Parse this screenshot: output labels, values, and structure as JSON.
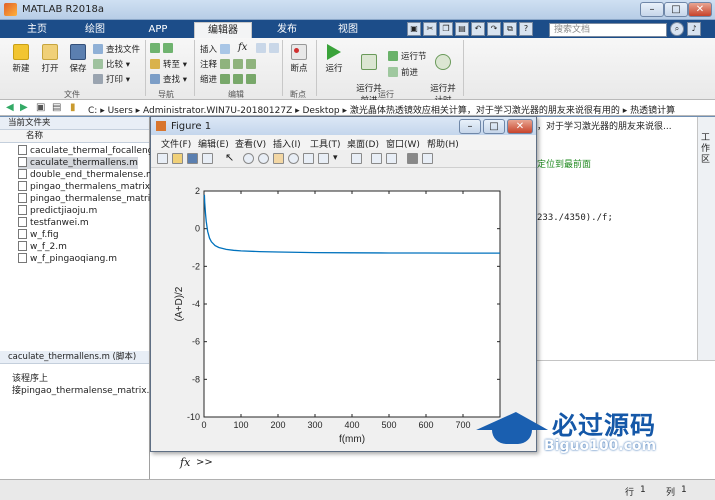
{
  "window": {
    "title": "MATLAB R2018a"
  },
  "tabs": [
    "主页",
    "绘图",
    "APP",
    "编辑器",
    "发布",
    "视图"
  ],
  "search": {
    "placeholder": "搜索文档"
  },
  "ribbon": {
    "file": {
      "new": "新建",
      "open": "打开",
      "save": "保存",
      "find_files": "查找文件",
      "compare": "比较",
      "print": "打印",
      "group": "文件"
    },
    "navigate": {
      "goto": "转至",
      "find": "查找",
      "group": "导航"
    },
    "edit": {
      "insert": "插入",
      "comment": "注释",
      "indent": "缩进",
      "fx": "fx",
      "group": "编辑"
    },
    "breakpoints": {
      "label": "断点",
      "group": "断点"
    },
    "run": {
      "run": "运行",
      "run_advance": "运行并\n前进",
      "run_section": "运行节",
      "advance": "前进",
      "run_time": "运行并\n计时",
      "group": "运行"
    }
  },
  "address": {
    "segments": [
      "C:",
      "Users",
      "Administrator.WIN7U-20180127Z",
      "Desktop",
      "激光晶体热透镜效应相关计算，对于学习激光器的朋友来说很有用的",
      "热透镜计算"
    ]
  },
  "file_panel": {
    "title": "当前文件夹",
    "column": "名称",
    "files": [
      "caculate_thermal_focallength.m",
      "caculate_thermallens.m",
      "double_end_thermalense.m",
      "pingao_thermalens_matrix.m",
      "pingao_thermalense_matrix.asv",
      "predictjiaoju.m",
      "testfanwei.m",
      "w_f.fig",
      "w_f_2.m",
      "w_f_pingaoqiang.m"
    ],
    "selected_index": 1
  },
  "details_panel": {
    "title": "caculate_thermallens.m  (脚本)",
    "lines": [
      "该程序上",
      "接pingao_thermalense_matrix.m主程"
    ]
  },
  "editor": {
    "title_tail": "，对于学习激光器的朋友来说很...",
    "code": [
      {
        "text": "定位到最前面",
        "color": "#228b22"
      },
      {
        "text": "233./4350)./f;",
        "color": "#222222"
      }
    ]
  },
  "command_window": {
    "prompt": ">>"
  },
  "statusbar": {
    "row_label": "行",
    "row": "1",
    "col_label": "列",
    "col": "1"
  },
  "figure": {
    "title": "Figure 1",
    "menu": [
      "文件(F)",
      "编辑(E)",
      "查看(V)",
      "插入(I)",
      "工具(T)",
      "桌面(D)",
      "窗口(W)",
      "帮助(H)"
    ]
  },
  "chart_data": {
    "type": "line",
    "title": "",
    "xlabel": "f(mm)",
    "ylabel": "(A+D)/2",
    "xlim": [
      0,
      800
    ],
    "ylim": [
      -10,
      2
    ],
    "xticks": [
      0,
      100,
      200,
      300,
      400,
      500,
      600,
      700
    ],
    "yticks": [
      2,
      0,
      -2,
      -4,
      -6,
      -8,
      -10
    ],
    "grid": false,
    "series": [
      {
        "color": "#0072bd",
        "x": [
          1,
          2,
          4,
          6,
          8,
          10,
          15,
          20,
          30,
          40,
          60,
          80,
          100,
          150,
          200,
          300,
          400,
          500,
          600,
          700,
          800
        ],
        "y": [
          1.8,
          1.4,
          0.8,
          0.4,
          0.1,
          -0.15,
          -0.5,
          -0.7,
          -0.9,
          -1.0,
          -1.1,
          -1.15,
          -1.18,
          -1.22,
          -1.24,
          -1.27,
          -1.28,
          -1.29,
          -1.29,
          -1.3,
          -1.3
        ]
      }
    ]
  },
  "watermark": {
    "cn": "必过源码",
    "en": "Biguo100.com"
  }
}
